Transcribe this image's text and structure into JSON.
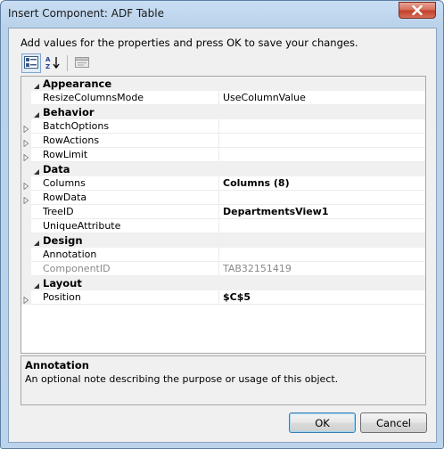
{
  "window": {
    "title": "Insert Component: ADF Table",
    "close_icon": "close-icon"
  },
  "instruction": "Add values for the properties and press OK to save your changes.",
  "toolbar": {
    "categorized_icon": "categorized-view-icon",
    "alphabetical_icon": "alphabetical-sort-icon",
    "property_pages_icon": "property-pages-icon"
  },
  "categories": {
    "appearance": "Appearance",
    "behavior": "Behavior",
    "data": "Data",
    "design": "Design",
    "layout": "Layout"
  },
  "properties": {
    "resize_columns_mode": {
      "name": "ResizeColumnsMode",
      "value": "UseColumnValue"
    },
    "batch_options": {
      "name": "BatchOptions",
      "value": ""
    },
    "row_actions": {
      "name": "RowActions",
      "value": ""
    },
    "row_limit": {
      "name": "RowLimit",
      "value": ""
    },
    "columns": {
      "name": "Columns",
      "value": "Columns (8)"
    },
    "row_data": {
      "name": "RowData",
      "value": ""
    },
    "tree_id": {
      "name": "TreeID",
      "value": "DepartmentsView1"
    },
    "unique_attribute": {
      "name": "UniqueAttribute",
      "value": ""
    },
    "annotation": {
      "name": "Annotation",
      "value": ""
    },
    "component_id": {
      "name": "ComponentID",
      "value": "TAB32151419"
    },
    "position": {
      "name": "Position",
      "value": "$C$5"
    }
  },
  "description": {
    "title": "Annotation",
    "text": "An optional note describing the purpose or usage of this object."
  },
  "buttons": {
    "ok": "OK",
    "cancel": "Cancel"
  }
}
